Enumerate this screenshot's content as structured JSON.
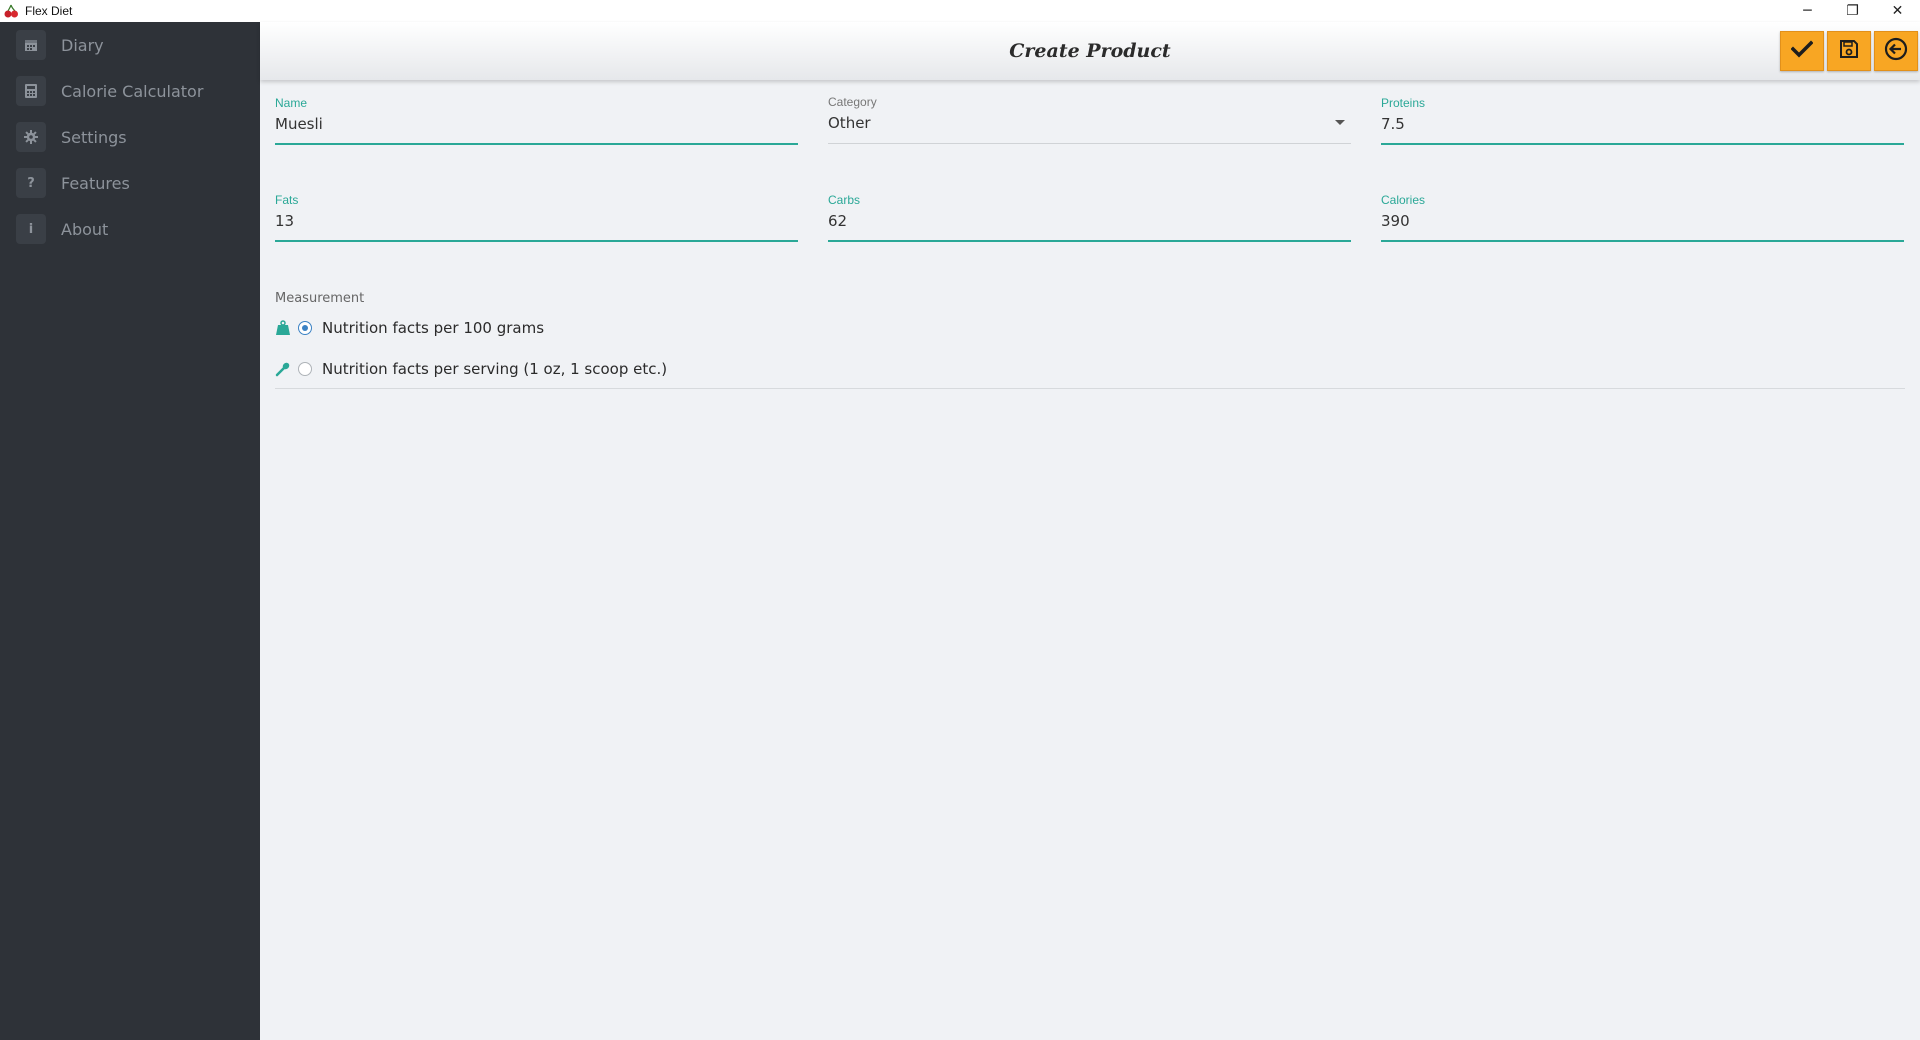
{
  "window": {
    "title": "Flex Diet",
    "controls": {
      "minimize": "─",
      "restore": "❐",
      "close": "✕"
    }
  },
  "sidebar": {
    "items": [
      {
        "label": "Diary",
        "icon": "calendar-icon"
      },
      {
        "label": "Calorie Calculator",
        "icon": "calculator-icon"
      },
      {
        "label": "Settings",
        "icon": "gear-icon"
      },
      {
        "label": "Features",
        "icon": "question-icon"
      },
      {
        "label": "About",
        "icon": "info-icon"
      }
    ]
  },
  "header": {
    "title": "Create Product",
    "actions": [
      "check-icon",
      "save-icon",
      "back-arrow-icon"
    ]
  },
  "form": {
    "name": {
      "label": "Name",
      "value": "Muesli"
    },
    "category": {
      "label": "Category",
      "value": "Other"
    },
    "proteins": {
      "label": "Proteins",
      "value": "7.5"
    },
    "fats": {
      "label": "Fats",
      "value": "13"
    },
    "carbs": {
      "label": "Carbs",
      "value": "62"
    },
    "calories": {
      "label": "Calories",
      "value": "390"
    },
    "measurement": {
      "label": "Measurement",
      "options": [
        {
          "label": "Nutrition facts per 100 grams",
          "icon": "weight-icon",
          "checked": true
        },
        {
          "label": "Nutrition facts per serving (1 oz, 1 scoop etc.)",
          "icon": "spoon-icon",
          "checked": false
        }
      ]
    }
  },
  "colors": {
    "accent": "#2aa897",
    "action": "#f8a623",
    "sidebar_bg": "#2e3238",
    "radio": "#3b82c4"
  }
}
